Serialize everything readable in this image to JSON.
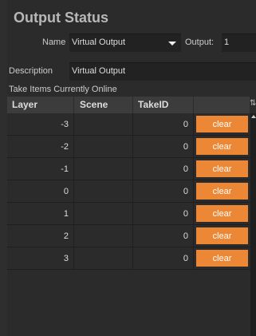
{
  "title": "Output Status",
  "name_label": "Name",
  "name_value": "Virtual Output",
  "output_label": "Output:",
  "output_value": "1",
  "description_label": "Description",
  "description_value": "Virtual Output",
  "section_label": "Take Items Currently Online",
  "columns": [
    "Layer",
    "Scene",
    "TakeID"
  ],
  "rows": [
    {
      "layer": "-3",
      "scene": "",
      "takeid": "0",
      "action": "clear"
    },
    {
      "layer": "-2",
      "scene": "",
      "takeid": "0",
      "action": "clear"
    },
    {
      "layer": "-1",
      "scene": "",
      "takeid": "0",
      "action": "clear"
    },
    {
      "layer": "0",
      "scene": "",
      "takeid": "0",
      "action": "clear"
    },
    {
      "layer": "1",
      "scene": "",
      "takeid": "0",
      "action": "clear"
    },
    {
      "layer": "2",
      "scene": "",
      "takeid": "0",
      "action": "clear"
    },
    {
      "layer": "3",
      "scene": "",
      "takeid": "0",
      "action": "clear"
    }
  ],
  "colors": {
    "accent": "#ec8736",
    "background": "#2b2b2b",
    "header": "#3c3c3c"
  },
  "icons": {
    "dropdown": "chevron-down-icon",
    "corner": "table-settings-icon",
    "scroll_up": "scroll-up-icon"
  }
}
